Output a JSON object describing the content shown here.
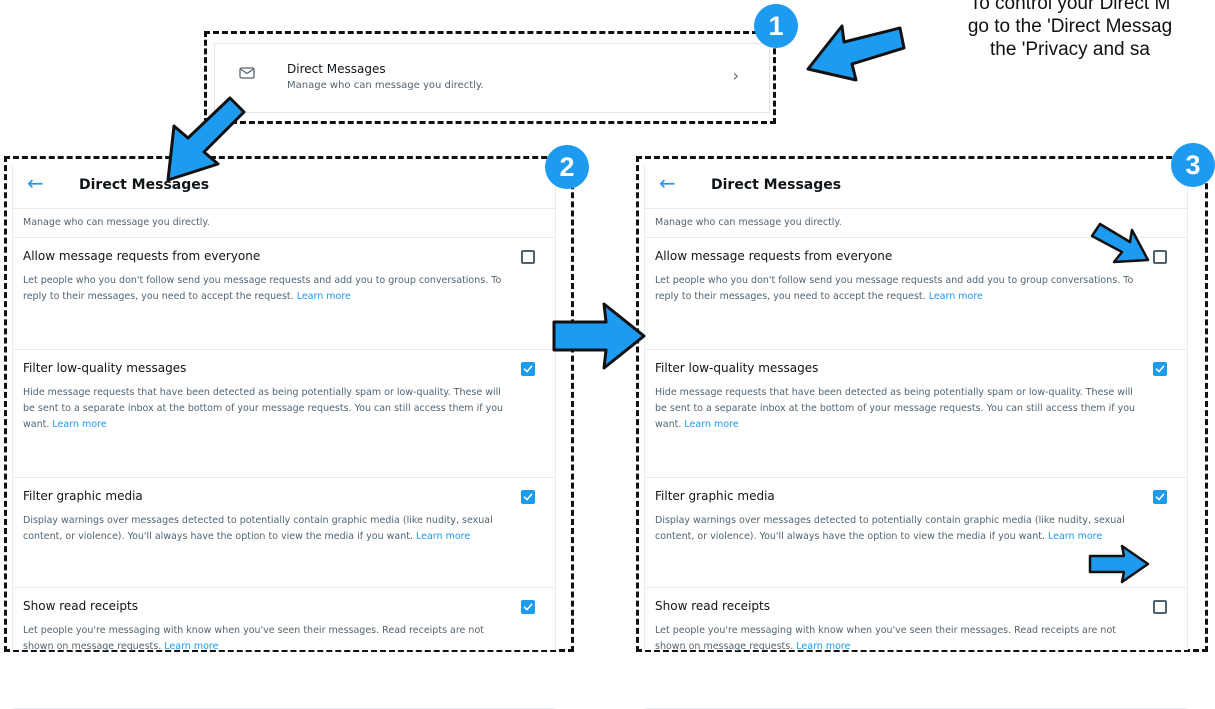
{
  "instruction": {
    "line1": "To control your Direct M",
    "line2": "go to the 'Direct Messag",
    "line3": "the 'Privacy and sa"
  },
  "steps": [
    "1",
    "2",
    "3"
  ],
  "entry": {
    "title": "Direct Messages",
    "subtitle": "Manage who can message you directly.",
    "icon": "envelope-icon"
  },
  "panel": {
    "title": "Direct Messages",
    "subtitle": "Manage who can message you directly.",
    "learn_more": "Learn more",
    "settings": [
      {
        "label": "Allow message requests from everyone",
        "desc": "Let people who you don't follow send you message requests and add you to group conversations. To reply to their messages, you need to accept the request."
      },
      {
        "label": "Filter low-quality messages",
        "desc": "Hide message requests that have been detected as being potentially spam or low-quality. These will be sent to a separate inbox at the bottom of your message requests. You can still access them if you want."
      },
      {
        "label": "Filter graphic media",
        "desc": "Display warnings over messages detected to potentially contain graphic media (like nudity, sexual content, or violence). You'll always have the option to view the media if you want."
      },
      {
        "label": "Show read receipts",
        "desc": "Let people you're messaging with know when you've seen their messages. Read receipts are not shown on message requests."
      }
    ]
  },
  "before_checked": [
    false,
    true,
    true,
    true
  ],
  "after_checked": [
    false,
    true,
    true,
    false
  ],
  "colors": {
    "accent": "#1d9bf0",
    "text": "#0f1419",
    "muted": "#536471"
  }
}
